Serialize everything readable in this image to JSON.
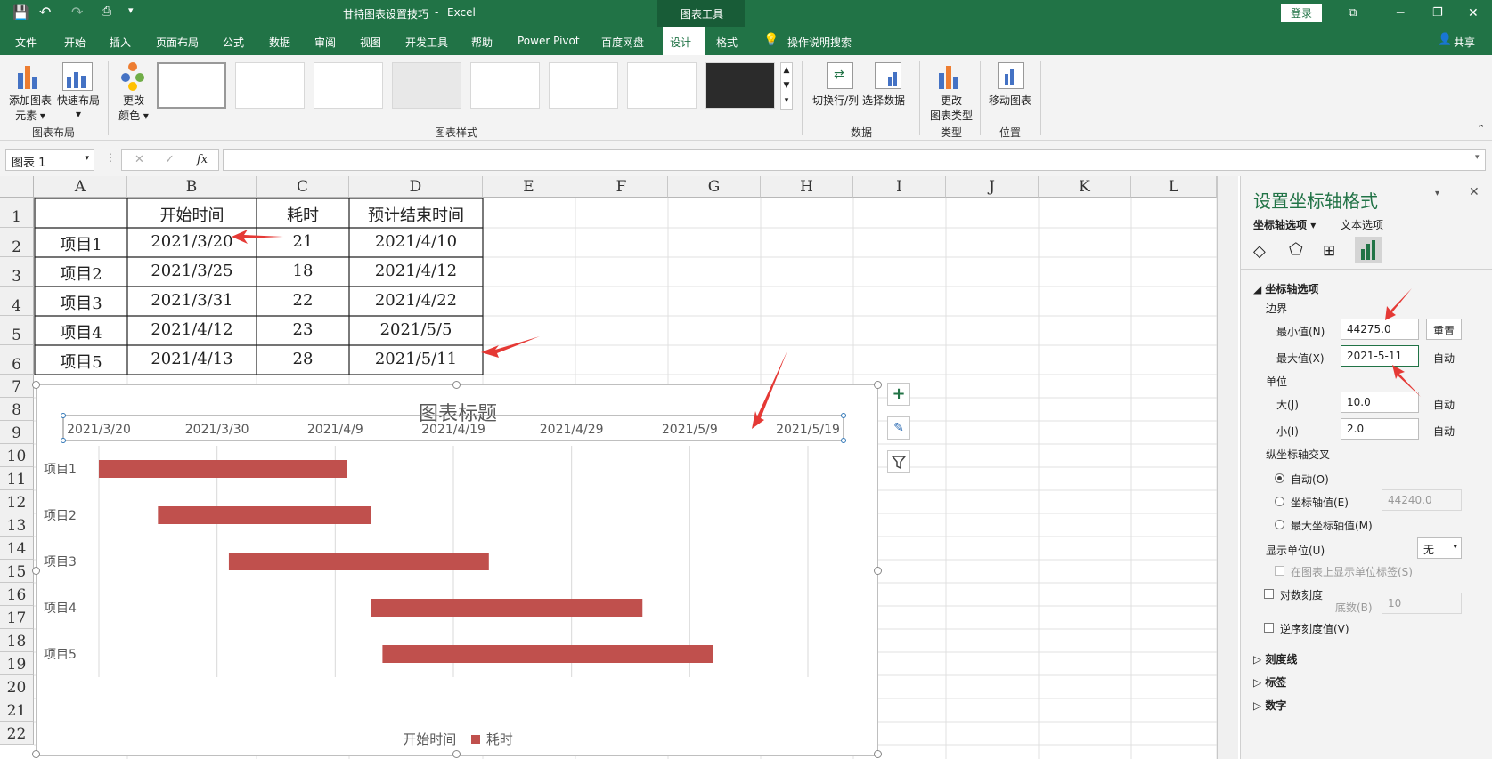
{
  "titlebar": {
    "file_title": "甘特图表设置技巧",
    "app": "Excel",
    "separator": "-",
    "context_tab": "图表工具",
    "login": "登录"
  },
  "menu": {
    "items": [
      "文件",
      "开始",
      "插入",
      "页面布局",
      "公式",
      "数据",
      "审阅",
      "视图",
      "开发工具",
      "帮助",
      "Power Pivot",
      "百度网盘",
      "设计",
      "格式"
    ],
    "search": "操作说明搜索",
    "share": "共享",
    "active": "设计"
  },
  "ribbon": {
    "add_element": [
      "添加图表",
      "元素"
    ],
    "quick_layout": "快速布局",
    "group_layout": "图表布局",
    "change_color": [
      "更改",
      "颜色"
    ],
    "group_styles": "图表样式",
    "switch_rowcol": "切换行/列",
    "select_data": "选择数据",
    "group_data": "数据",
    "change_type": [
      "更改",
      "图表类型"
    ],
    "group_type": "类型",
    "move_chart": "移动图表",
    "group_location": "位置"
  },
  "formula": {
    "name_box": "图表 1",
    "fx": "fx",
    "cancel": "✕",
    "enter": "✓",
    "value": ""
  },
  "columns": [
    "A",
    "B",
    "C",
    "D",
    "E",
    "F",
    "G",
    "H",
    "I",
    "J",
    "K",
    "L"
  ],
  "rows": [
    "1",
    "2",
    "3",
    "4",
    "5",
    "6",
    "7",
    "8",
    "9",
    "10",
    "11",
    "12",
    "13",
    "14",
    "15",
    "16",
    "17",
    "18",
    "19",
    "20",
    "21",
    "22"
  ],
  "table": {
    "header": [
      "",
      "开始时间",
      "耗时",
      "预计结束时间"
    ],
    "rows": [
      [
        "项目1",
        "2021/3/20",
        "21",
        "2021/4/10"
      ],
      [
        "项目2",
        "2021/3/25",
        "18",
        "2021/4/12"
      ],
      [
        "项目3",
        "2021/3/31",
        "22",
        "2021/4/22"
      ],
      [
        "项目4",
        "2021/4/12",
        "23",
        "2021/5/5"
      ],
      [
        "项目5",
        "2021/4/13",
        "28",
        "2021/5/11"
      ]
    ]
  },
  "chart_data": {
    "type": "bar",
    "title": "图表标题",
    "x_axis": {
      "position": "top",
      "min": "2021/3/20",
      "max": "2021/5/19",
      "major_unit_days": 10,
      "tick_labels": [
        "2021/3/20",
        "2021/3/30",
        "2021/4/9",
        "2021/4/19",
        "2021/4/29",
        "2021/5/9",
        "2021/5/19"
      ]
    },
    "categories": [
      "项目1",
      "项目2",
      "项目3",
      "项目4",
      "项目5"
    ],
    "series": [
      {
        "name": "开始时间",
        "values": [
          "2021/3/20",
          "2021/3/25",
          "2021/3/31",
          "2021/4/12",
          "2021/4/13"
        ],
        "color": "none"
      },
      {
        "name": "耗时",
        "values": [
          21,
          18,
          22,
          23,
          28
        ],
        "color": "#c0504d"
      }
    ],
    "legend": "bottom",
    "grid": true
  },
  "chart_tools": [
    "add-element",
    "style-brush",
    "filter"
  ],
  "panel": {
    "title": "设置坐标轴格式",
    "tabs": [
      "坐标轴选项",
      "文本选项"
    ],
    "section": "坐标轴选项",
    "bounds_label": "边界",
    "min_label": "最小值(N)",
    "min_value": "44275.0",
    "reset": "重置",
    "max_label": "最大值(X)",
    "max_value": "2021-5-11",
    "max_state": "自动",
    "units_label": "单位",
    "major_label": "大(J)",
    "major_value": "10.0",
    "major_state": "自动",
    "minor_label": "小(I)",
    "minor_value": "2.0",
    "minor_state": "自动",
    "cross_label": "纵坐标轴交叉",
    "cross_auto": "自动(O)",
    "cross_value_label": "坐标轴值(E)",
    "cross_value": "44240.0",
    "cross_max": "最大坐标轴值(M)",
    "display_units_label": "显示单位(U)",
    "display_units_value": "无",
    "show_units_label": "在图表上显示单位标签(S)",
    "log_label": "对数刻度",
    "base_label": "底数(B)",
    "base_value": "10",
    "reverse_label": "逆序刻度值(V)",
    "collapsed": [
      "刻度线",
      "标签",
      "数字"
    ]
  },
  "colors": {
    "excel_green": "#217346",
    "bar_red": "#c0504d",
    "arrow_red": "#e53935"
  }
}
